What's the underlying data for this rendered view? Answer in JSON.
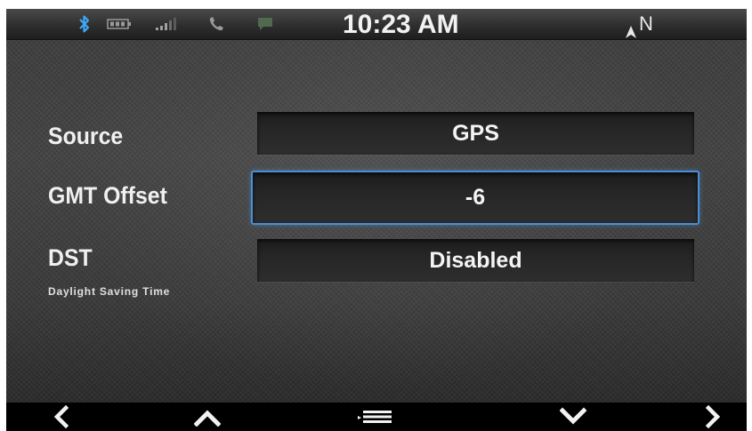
{
  "status_bar": {
    "time": "10:23 AM",
    "compass_heading": "N",
    "icons": [
      "bluetooth-icon",
      "battery-icon",
      "signal-icon",
      "phone-icon",
      "message-icon",
      "compass-arrow-icon"
    ],
    "colors": {
      "bluetooth": "#3fa9f5",
      "dim_icon": "#8a8a8a",
      "message": "#4f6a4f"
    }
  },
  "settings": [
    {
      "label": "Source",
      "value": "GPS",
      "selected": false
    },
    {
      "label": "GMT Offset",
      "value": "-6",
      "selected": true
    },
    {
      "label": "DST",
      "sublabel": "Daylight Saving Time",
      "value": "Disabled",
      "selected": false
    }
  ],
  "nav": {
    "icons": [
      "chevron-left-icon",
      "chevron-up-icon",
      "menu-icon",
      "chevron-down-icon",
      "chevron-right-icon"
    ]
  },
  "colors": {
    "selection_border": "#4a8fd6",
    "text": "#f0f0f0"
  }
}
